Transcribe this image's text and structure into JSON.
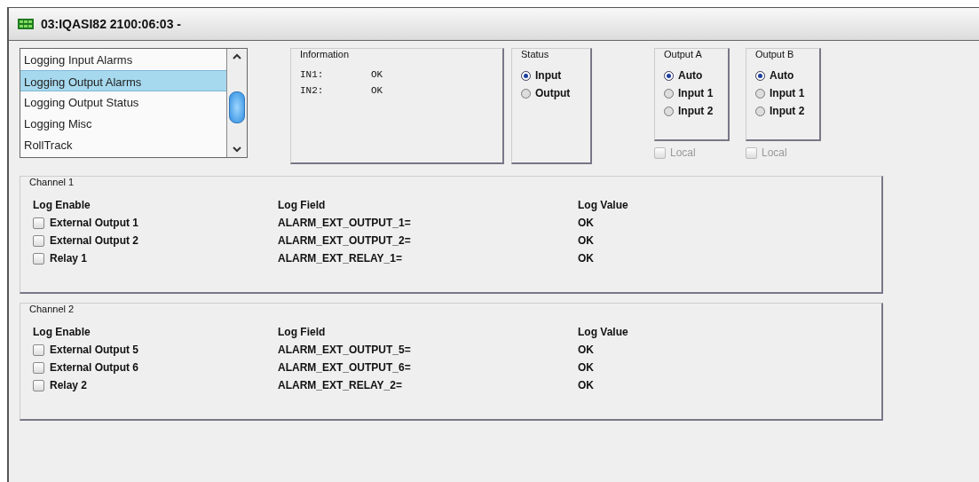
{
  "window": {
    "title": "03:IQASI82  2100:06:03  -"
  },
  "menu_list": [
    {
      "label": "Logging Input Alarms",
      "selected": false
    },
    {
      "label": "Logging Output Alarms",
      "selected": true
    },
    {
      "label": "Logging Output Status",
      "selected": false
    },
    {
      "label": "Logging Misc",
      "selected": false
    },
    {
      "label": "RollTrack",
      "selected": false
    }
  ],
  "information": {
    "title": "Information",
    "rows": [
      {
        "label": "IN1:",
        "value": "OK"
      },
      {
        "label": "IN2:",
        "value": "OK"
      }
    ]
  },
  "status": {
    "title": "Status",
    "options": [
      {
        "label": "Input",
        "selected": true
      },
      {
        "label": "Output",
        "selected": false
      }
    ]
  },
  "outputs": [
    {
      "title": "Output A",
      "options": [
        {
          "label": "Auto",
          "selected": true
        },
        {
          "label": "Input 1",
          "selected": false
        },
        {
          "label": "Input 2",
          "selected": false
        }
      ],
      "local": {
        "label": "Local",
        "checked": false,
        "disabled": true
      }
    },
    {
      "title": "Output B",
      "options": [
        {
          "label": "Auto",
          "selected": true
        },
        {
          "label": "Input 1",
          "selected": false
        },
        {
          "label": "Input 2",
          "selected": false
        }
      ],
      "local": {
        "label": "Local",
        "checked": false,
        "disabled": true
      }
    }
  ],
  "channels": [
    {
      "title": "Channel 1",
      "columns": [
        "Log Enable",
        "Log Field",
        "Log Value"
      ],
      "rows": [
        {
          "label": "External Output 1",
          "checked": false,
          "field": "ALARM_EXT_OUTPUT_1=",
          "value": "OK"
        },
        {
          "label": "External Output 2",
          "checked": false,
          "field": "ALARM_EXT_OUTPUT_2=",
          "value": "OK"
        },
        {
          "label": "Relay 1",
          "checked": false,
          "field": "ALARM_EXT_RELAY_1=",
          "value": "OK"
        }
      ]
    },
    {
      "title": "Channel 2",
      "columns": [
        "Log Enable",
        "Log Field",
        "Log Value"
      ],
      "rows": [
        {
          "label": "External Output 5",
          "checked": false,
          "field": "ALARM_EXT_OUTPUT_5=",
          "value": "OK"
        },
        {
          "label": "External Output 6",
          "checked": false,
          "field": "ALARM_EXT_OUTPUT_6=",
          "value": "OK"
        },
        {
          "label": "Relay 2",
          "checked": false,
          "field": "ALARM_EXT_RELAY_2=",
          "value": "OK"
        }
      ]
    }
  ]
}
